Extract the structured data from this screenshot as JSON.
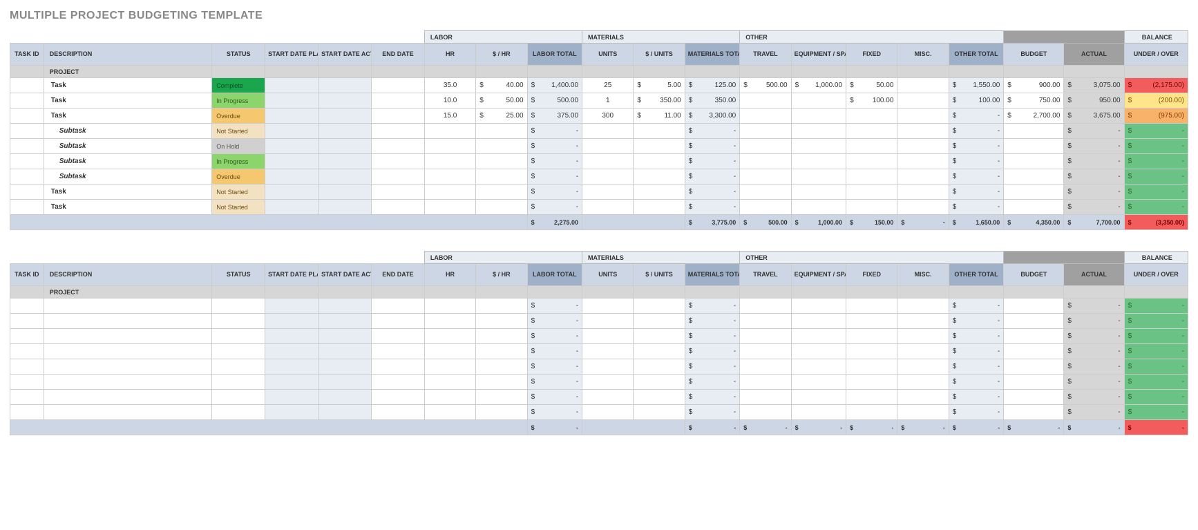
{
  "title": "MULTIPLE PROJECT BUDGETING TEMPLATE",
  "groups": {
    "labor": "LABOR",
    "materials": "MATERIALS",
    "other": "OTHER",
    "balance": "BALANCE"
  },
  "cols": {
    "task_id": "TASK ID",
    "description": "DESCRIPTION",
    "status": "STATUS",
    "start_planned": "START DATE PLANNED",
    "start_actual": "START DATE ACTUAL",
    "end_date": "END DATE",
    "hr": "HR",
    "rate": "$ / HR",
    "labor_total": "LABOR TOTAL",
    "units": "UNITS",
    "unit_cost": "$ / UNITS",
    "mat_total": "MATERIALS TOTAL",
    "travel": "TRAVEL",
    "equip": "EQUIPMENT / SPACE",
    "fixed": "FIXED",
    "misc": "MISC.",
    "other_total": "OTHER TOTAL",
    "budget": "BUDGET",
    "actual": "ACTUAL",
    "under_over": "UNDER / OVER"
  },
  "project_label": "PROJECT",
  "status_labels": {
    "complete": "Complete",
    "inprogress": "In Progress",
    "overdue": "Overdue",
    "notstarted": "Not Started",
    "onhold": "On Hold"
  },
  "tables": [
    {
      "rows": [
        {
          "type": "task",
          "desc": "Task",
          "status": "complete",
          "hr": "35.0",
          "rate": "40.00",
          "labor_total": "1,400.00",
          "units": "25",
          "unit_cost": "5.00",
          "mat_total": "125.00",
          "travel": "500.00",
          "equip": "1,000.00",
          "fixed": "50.00",
          "misc": "",
          "other_total": "1,550.00",
          "budget": "900.00",
          "actual": "3,075.00",
          "balance": "(2,175.00)",
          "balance_class": "red"
        },
        {
          "type": "task",
          "desc": "Task",
          "status": "inprogress",
          "hr": "10.0",
          "rate": "50.00",
          "labor_total": "500.00",
          "units": "1",
          "unit_cost": "350.00",
          "mat_total": "350.00",
          "travel": "",
          "equip": "",
          "fixed": "100.00",
          "misc": "",
          "other_total": "100.00",
          "budget": "750.00",
          "actual": "950.00",
          "balance": "(200.00)",
          "balance_class": "yellow"
        },
        {
          "type": "task",
          "desc": "Task",
          "status": "overdue",
          "hr": "15.0",
          "rate": "25.00",
          "labor_total": "375.00",
          "units": "300",
          "unit_cost": "11.00",
          "mat_total": "3,300.00",
          "travel": "",
          "equip": "",
          "fixed": "",
          "misc": "",
          "other_total": "-",
          "budget": "2,700.00",
          "actual": "3,675.00",
          "balance": "(975.00)",
          "balance_class": "orange"
        },
        {
          "type": "subtask",
          "desc": "Subtask",
          "status": "notstarted",
          "hr": "",
          "rate": "",
          "labor_total": "-",
          "units": "",
          "unit_cost": "",
          "mat_total": "-",
          "travel": "",
          "equip": "",
          "fixed": "",
          "misc": "",
          "other_total": "-",
          "budget": "",
          "actual": "-",
          "balance": "-",
          "balance_class": "green"
        },
        {
          "type": "subtask",
          "desc": "Subtask",
          "status": "onhold",
          "hr": "",
          "rate": "",
          "labor_total": "-",
          "units": "",
          "unit_cost": "",
          "mat_total": "-",
          "travel": "",
          "equip": "",
          "fixed": "",
          "misc": "",
          "other_total": "-",
          "budget": "",
          "actual": "-",
          "balance": "-",
          "balance_class": "green"
        },
        {
          "type": "subtask",
          "desc": "Subtask",
          "status": "inprogress",
          "hr": "",
          "rate": "",
          "labor_total": "-",
          "units": "",
          "unit_cost": "",
          "mat_total": "-",
          "travel": "",
          "equip": "",
          "fixed": "",
          "misc": "",
          "other_total": "-",
          "budget": "",
          "actual": "-",
          "balance": "-",
          "balance_class": "green"
        },
        {
          "type": "subtask",
          "desc": "Subtask",
          "status": "overdue",
          "hr": "",
          "rate": "",
          "labor_total": "-",
          "units": "",
          "unit_cost": "",
          "mat_total": "-",
          "travel": "",
          "equip": "",
          "fixed": "",
          "misc": "",
          "other_total": "-",
          "budget": "",
          "actual": "-",
          "balance": "-",
          "balance_class": "green"
        },
        {
          "type": "task",
          "desc": "Task",
          "status": "notstarted",
          "hr": "",
          "rate": "",
          "labor_total": "-",
          "units": "",
          "unit_cost": "",
          "mat_total": "-",
          "travel": "",
          "equip": "",
          "fixed": "",
          "misc": "",
          "other_total": "-",
          "budget": "",
          "actual": "-",
          "balance": "-",
          "balance_class": "green"
        },
        {
          "type": "task",
          "desc": "Task",
          "status": "notstarted",
          "hr": "",
          "rate": "",
          "labor_total": "-",
          "units": "",
          "unit_cost": "",
          "mat_total": "-",
          "travel": "",
          "equip": "",
          "fixed": "",
          "misc": "",
          "other_total": "-",
          "budget": "",
          "actual": "-",
          "balance": "-",
          "balance_class": "green"
        }
      ],
      "totals": {
        "labor_total": "2,275.00",
        "mat_total": "3,775.00",
        "travel": "500.00",
        "equip": "1,000.00",
        "fixed": "150.00",
        "misc": "-",
        "other_total": "1,650.00",
        "budget": "4,350.00",
        "actual": "7,700.00",
        "balance": "(3,350.00)",
        "balance_class": "red"
      }
    },
    {
      "rows": [
        {
          "type": "task",
          "desc": "",
          "status": "",
          "hr": "",
          "rate": "",
          "labor_total": "-",
          "units": "",
          "unit_cost": "",
          "mat_total": "-",
          "travel": "",
          "equip": "",
          "fixed": "",
          "misc": "",
          "other_total": "-",
          "budget": "",
          "actual": "-",
          "balance": "-",
          "balance_class": "green"
        },
        {
          "type": "task",
          "desc": "",
          "status": "",
          "hr": "",
          "rate": "",
          "labor_total": "-",
          "units": "",
          "unit_cost": "",
          "mat_total": "-",
          "travel": "",
          "equip": "",
          "fixed": "",
          "misc": "",
          "other_total": "-",
          "budget": "",
          "actual": "-",
          "balance": "-",
          "balance_class": "green"
        },
        {
          "type": "task",
          "desc": "",
          "status": "",
          "hr": "",
          "rate": "",
          "labor_total": "-",
          "units": "",
          "unit_cost": "",
          "mat_total": "-",
          "travel": "",
          "equip": "",
          "fixed": "",
          "misc": "",
          "other_total": "-",
          "budget": "",
          "actual": "-",
          "balance": "-",
          "balance_class": "green"
        },
        {
          "type": "task",
          "desc": "",
          "status": "",
          "hr": "",
          "rate": "",
          "labor_total": "-",
          "units": "",
          "unit_cost": "",
          "mat_total": "-",
          "travel": "",
          "equip": "",
          "fixed": "",
          "misc": "",
          "other_total": "-",
          "budget": "",
          "actual": "-",
          "balance": "-",
          "balance_class": "green"
        },
        {
          "type": "task",
          "desc": "",
          "status": "",
          "hr": "",
          "rate": "",
          "labor_total": "-",
          "units": "",
          "unit_cost": "",
          "mat_total": "-",
          "travel": "",
          "equip": "",
          "fixed": "",
          "misc": "",
          "other_total": "-",
          "budget": "",
          "actual": "-",
          "balance": "-",
          "balance_class": "green"
        },
        {
          "type": "task",
          "desc": "",
          "status": "",
          "hr": "",
          "rate": "",
          "labor_total": "-",
          "units": "",
          "unit_cost": "",
          "mat_total": "-",
          "travel": "",
          "equip": "",
          "fixed": "",
          "misc": "",
          "other_total": "-",
          "budget": "",
          "actual": "-",
          "balance": "-",
          "balance_class": "green"
        },
        {
          "type": "task",
          "desc": "",
          "status": "",
          "hr": "",
          "rate": "",
          "labor_total": "-",
          "units": "",
          "unit_cost": "",
          "mat_total": "-",
          "travel": "",
          "equip": "",
          "fixed": "",
          "misc": "",
          "other_total": "-",
          "budget": "",
          "actual": "-",
          "balance": "-",
          "balance_class": "green"
        },
        {
          "type": "task",
          "desc": "",
          "status": "",
          "hr": "",
          "rate": "",
          "labor_total": "-",
          "units": "",
          "unit_cost": "",
          "mat_total": "-",
          "travel": "",
          "equip": "",
          "fixed": "",
          "misc": "",
          "other_total": "-",
          "budget": "",
          "actual": "-",
          "balance": "-",
          "balance_class": "green"
        }
      ],
      "totals": {
        "labor_total": "-",
        "mat_total": "-",
        "travel": "-",
        "equip": "-",
        "fixed": "-",
        "misc": "-",
        "other_total": "-",
        "budget": "-",
        "actual": "-",
        "balance": "-",
        "balance_class": "red"
      }
    }
  ]
}
